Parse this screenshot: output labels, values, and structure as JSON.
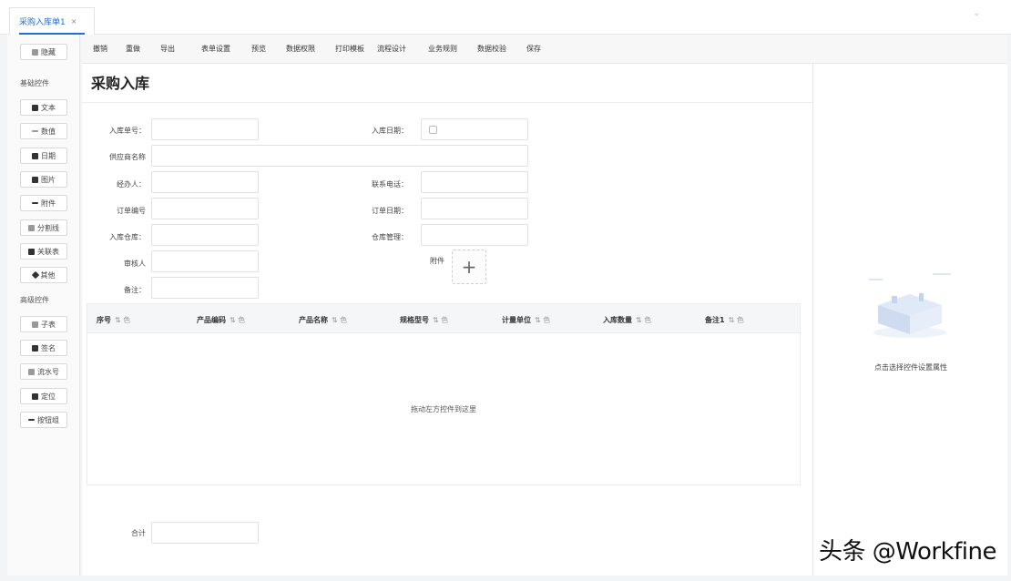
{
  "tabs": [
    {
      "label": "采购入库单1",
      "close": "×"
    }
  ],
  "tabbar": {
    "chevron": "⌄"
  },
  "sidebar": {
    "top_button": {
      "label": "隐藏",
      "icon": "save-icon"
    },
    "groups": [
      {
        "label": "基础控件",
        "items": [
          {
            "label": "文本",
            "icon": "text-icon"
          },
          {
            "label": "数值",
            "icon": "number-icon"
          },
          {
            "label": "日期",
            "icon": "calendar-icon"
          },
          {
            "label": "图片",
            "icon": "image-icon"
          },
          {
            "label": "附件",
            "icon": "attachment-icon"
          },
          {
            "label": "分割线",
            "icon": "divider-icon"
          },
          {
            "label": "关联表",
            "icon": "link-table-icon"
          },
          {
            "label": "其他",
            "icon": "diamond-icon"
          }
        ]
      },
      {
        "label": "高级控件",
        "items": [
          {
            "label": "子表",
            "icon": "subtable-icon"
          },
          {
            "label": "签名",
            "icon": "pen-icon"
          },
          {
            "label": "流水号",
            "icon": "serial-icon"
          },
          {
            "label": "定位",
            "icon": "location-icon"
          },
          {
            "label": "按钮组",
            "icon": "button-group-icon"
          }
        ]
      }
    ]
  },
  "toolbar": {
    "items": [
      "撤销",
      "重做",
      "导出",
      "表单设置",
      "预览",
      "数据权限",
      "打印模板",
      "流程设计",
      "业务规则",
      "数据校验",
      "保存"
    ]
  },
  "form": {
    "title": "采购入库",
    "fields": {
      "inbound_no": {
        "label": "入库单号：",
        "value": ""
      },
      "inbound_date": {
        "label": "入库日期：",
        "value": ""
      },
      "supplier": {
        "label": "供应商名称",
        "value": ""
      },
      "handler": {
        "label": "经办人：",
        "value": ""
      },
      "contact_phone": {
        "label": "联系电话：",
        "value": ""
      },
      "order_no": {
        "label": "订单编号",
        "value": ""
      },
      "order_date": {
        "label": "订单日期：",
        "value": ""
      },
      "inbound_warehouse": {
        "label": "入库仓库：",
        "value": ""
      },
      "warehouse_manager": {
        "label": "仓库管理：",
        "value": ""
      },
      "reviewer": {
        "label": "审核人",
        "value": ""
      },
      "attachment": {
        "label": "附件",
        "plus": "+"
      },
      "remark": {
        "label": "备注：",
        "value": ""
      },
      "total": {
        "label": "合计",
        "value": ""
      }
    },
    "table": {
      "columns": [
        {
          "label": "序号",
          "sort": "⇅ 色"
        },
        {
          "label": "产品编码",
          "sort": "⇅ 色"
        },
        {
          "label": "产品名称",
          "sort": "⇅ 色"
        },
        {
          "label": "规格型号",
          "sort": "⇅ 色"
        },
        {
          "label": "计量单位",
          "sort": "⇅ 色"
        },
        {
          "label": "入库数量",
          "sort": "⇅ 色"
        },
        {
          "label": "备注1",
          "sort": "⇅ 色"
        }
      ],
      "empty_text": "拖动左方控件到这里"
    }
  },
  "right_panel": {
    "hint": "点击选择控件设置属性"
  },
  "watermark": "头条 @Workfine"
}
